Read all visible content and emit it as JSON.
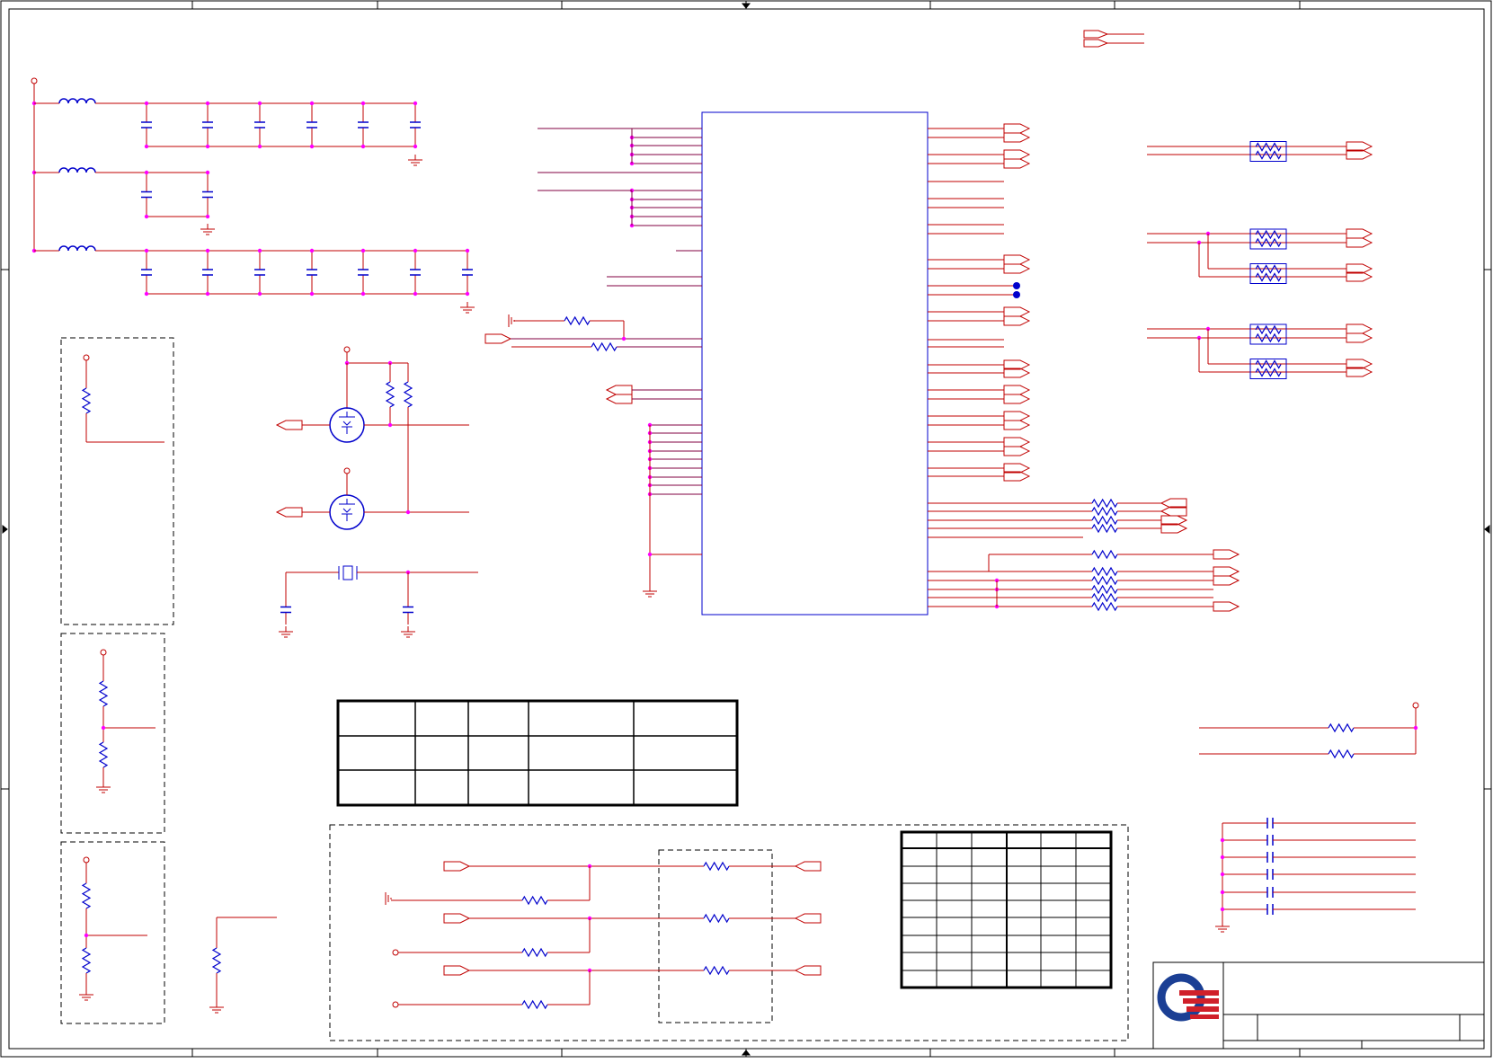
{
  "colors": {
    "wire": "#c00000",
    "net": "#800040",
    "component": "#0000cc",
    "junction": "#ff00ff",
    "frame": "#000000"
  },
  "sheet": {
    "title": "",
    "company_logo": "quanta-logo-icon"
  },
  "title_block": {
    "title": "",
    "project": "",
    "doc_number": "",
    "rev": "",
    "date": "",
    "sheet": ""
  },
  "ic_block": {
    "name": "",
    "part": ""
  },
  "strap_table": {
    "headers": [
      "",
      "",
      "",
      "",
      ""
    ],
    "rows": [
      [
        "",
        "",
        "",
        "",
        ""
      ],
      [
        "",
        "",
        "",
        "",
        ""
      ]
    ]
  },
  "config_table": {
    "rows": [
      [
        "",
        "",
        "",
        "",
        "",
        ""
      ],
      [
        "",
        "",
        "",
        "",
        "",
        ""
      ],
      [
        "",
        "",
        "",
        "",
        "",
        ""
      ],
      [
        "",
        "",
        "",
        "",
        "",
        ""
      ],
      [
        "",
        "",
        "",
        "",
        "",
        ""
      ],
      [
        "",
        "",
        "",
        "",
        "",
        ""
      ],
      [
        "",
        "",
        "",
        "",
        "",
        ""
      ],
      [
        "",
        "",
        "",
        "",
        "",
        ""
      ]
    ]
  }
}
